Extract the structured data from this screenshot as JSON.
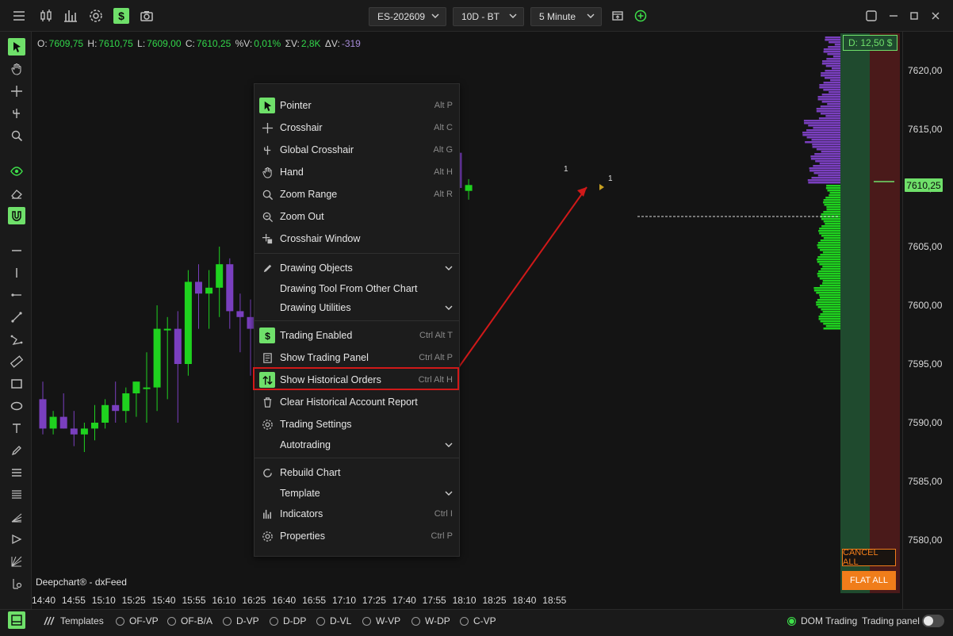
{
  "topbar": {
    "symbol": "ES-202609",
    "range": "10D - BT",
    "timeframe": "5 Minute"
  },
  "ohlc": {
    "o_label": "O:",
    "o_value": "7609,75",
    "h_label": "H:",
    "h_value": "7610,75",
    "l_label": "L:",
    "l_value": "7609,00",
    "c_label": "C:",
    "c_value": "7610,25",
    "pctv_label": "%V:",
    "pctv_value": "0,01%",
    "sumv_label": "ΣV:",
    "sumv_value": "2,8K",
    "dv_label": "ΔV:",
    "dv_value": "-319"
  },
  "vendor": "Deepchart® - dxFeed",
  "time_ticks": [
    "14:40",
    "14:55",
    "15:10",
    "15:25",
    "15:40",
    "15:55",
    "16:10",
    "16:25",
    "16:40",
    "16:55",
    "17:10",
    "17:25",
    "17:40",
    "17:55",
    "18:10",
    "18:25",
    "18:40",
    "18:55"
  ],
  "price_ticks": [
    "7620,00",
    "7615,00",
    "7610,00",
    "7605,00",
    "7600,00",
    "7595,00",
    "7590,00",
    "7585,00",
    "7580,00"
  ],
  "last_price": "7610,25",
  "dom": {
    "badge": "D: 12,50 $",
    "cancel_all": "CANCEL ALL",
    "flat_all": "FLAT ALL"
  },
  "order_marker": "1",
  "menu": {
    "pointer": {
      "label": "Pointer",
      "shortcut": "Alt P"
    },
    "crosshair": {
      "label": "Crosshair",
      "shortcut": "Alt C"
    },
    "global_crosshair": {
      "label": "Global Crosshair",
      "shortcut": "Alt G"
    },
    "hand": {
      "label": "Hand",
      "shortcut": "Alt H"
    },
    "zoom_range": {
      "label": "Zoom Range",
      "shortcut": "Alt R"
    },
    "zoom_out": {
      "label": "Zoom Out"
    },
    "crosshair_window": {
      "label": "Crosshair Window"
    },
    "drawing_objects": {
      "label": "Drawing Objects"
    },
    "drawing_tool_other": {
      "label": "Drawing Tool From Other Chart"
    },
    "drawing_utilities": {
      "label": "Drawing Utilities"
    },
    "trading_enabled": {
      "label": "Trading Enabled",
      "shortcut": "Ctrl Alt T"
    },
    "show_trading_panel": {
      "label": "Show Trading Panel",
      "shortcut": "Ctrl Alt P"
    },
    "show_historical_orders": {
      "label": "Show Historical Orders",
      "shortcut": "Ctrl Alt H"
    },
    "clear_historical_report": {
      "label": "Clear Historical Account Report"
    },
    "trading_settings": {
      "label": "Trading Settings"
    },
    "autotrading": {
      "label": "Autotrading"
    },
    "rebuild_chart": {
      "label": "Rebuild Chart"
    },
    "template": {
      "label": "Template"
    },
    "indicators": {
      "label": "Indicators",
      "shortcut": "Ctrl I"
    },
    "properties": {
      "label": "Properties",
      "shortcut": "Ctrl P"
    }
  },
  "bottombar": {
    "templates": "Templates",
    "presets": [
      "OF-VP",
      "OF-B/A",
      "D-VP",
      "D-DP",
      "D-VL",
      "W-VP",
      "W-DP",
      "C-VP"
    ],
    "dom_trading": "DOM Trading",
    "trading_panel": "Trading panel"
  },
  "colors": {
    "accent_green": "#6fe06a",
    "bull_candle": "#1fd21f",
    "bear_candle": "#7a3fbf",
    "highlight_red": "#d01919",
    "orange": "#f07d1a"
  },
  "chart_data": {
    "type": "candlestick",
    "interval": "5 Minute",
    "y_range": [
      7578,
      7624
    ],
    "candles": [
      {
        "o": 7592.0,
        "h": 7593.5,
        "l": 7589.0,
        "c": 7589.5
      },
      {
        "o": 7589.5,
        "h": 7591.0,
        "l": 7589.0,
        "c": 7590.5
      },
      {
        "o": 7590.5,
        "h": 7592.5,
        "l": 7589.5,
        "c": 7589.5
      },
      {
        "o": 7589.5,
        "h": 7591.0,
        "l": 7588.0,
        "c": 7589.0
      },
      {
        "o": 7589.0,
        "h": 7590.0,
        "l": 7587.5,
        "c": 7589.5
      },
      {
        "o": 7589.5,
        "h": 7591.5,
        "l": 7588.5,
        "c": 7590.0
      },
      {
        "o": 7590.0,
        "h": 7592.0,
        "l": 7589.5,
        "c": 7591.5
      },
      {
        "o": 7591.5,
        "h": 7593.5,
        "l": 7590.0,
        "c": 7591.0
      },
      {
        "o": 7591.0,
        "h": 7593.0,
        "l": 7590.0,
        "c": 7592.5
      },
      {
        "o": 7592.5,
        "h": 7593.5,
        "l": 7590.5,
        "c": 7593.5
      },
      {
        "o": 7593.0,
        "h": 7596.0,
        "l": 7590.0,
        "c": 7593.0
      },
      {
        "o": 7593.0,
        "h": 7600.0,
        "l": 7591.0,
        "c": 7598.0
      },
      {
        "o": 7598.0,
        "h": 7599.0,
        "l": 7592.0,
        "c": 7598.0
      },
      {
        "o": 7598.0,
        "h": 7599.5,
        "l": 7590.0,
        "c": 7595.0
      },
      {
        "o": 7595.0,
        "h": 7603.0,
        "l": 7594.0,
        "c": 7602.0
      },
      {
        "o": 7602.0,
        "h": 7603.5,
        "l": 7598.0,
        "c": 7601.0
      },
      {
        "o": 7601.0,
        "h": 7603.0,
        "l": 7598.0,
        "c": 7601.5
      },
      {
        "o": 7601.5,
        "h": 7605.0,
        "l": 7599.0,
        "c": 7603.5
      },
      {
        "o": 7603.5,
        "h": 7604.0,
        "l": 7598.0,
        "c": 7599.5
      },
      {
        "o": 7599.5,
        "h": 7601.0,
        "l": 7596.0,
        "c": 7599.0
      },
      {
        "o": 7599.0,
        "h": 7600.5,
        "l": 7594.0,
        "c": 7598.0
      },
      {
        "o": 7598.0,
        "h": 7601.0,
        "l": 7596.5,
        "c": 7600.0
      },
      {
        "o": 7600.0,
        "h": 7603.0,
        "l": 7599.0,
        "c": 7602.5
      },
      {
        "o": 7602.5,
        "h": 7604.5,
        "l": 7600.5,
        "c": 7600.5
      },
      {
        "o": 7600.5,
        "h": 7603.5,
        "l": 7599.0,
        "c": 7603.0
      },
      {
        "o": 7603.0,
        "h": 7604.5,
        "l": 7601.5,
        "c": 7604.0
      },
      {
        "o": 7604.0,
        "h": 7606.0,
        "l": 7602.5,
        "c": 7605.5
      },
      {
        "o": 7605.5,
        "h": 7606.5,
        "l": 7603.0,
        "c": 7603.5
      },
      {
        "o": 7603.5,
        "h": 7604.5,
        "l": 7600.5,
        "c": 7601.5
      },
      {
        "o": 7601.5,
        "h": 7603.5,
        "l": 7600.5,
        "c": 7603.0
      },
      {
        "o": 7603.0,
        "h": 7608.5,
        "l": 7602.5,
        "c": 7608.0
      },
      {
        "o": 7608.0,
        "h": 7608.5,
        "l": 7603.0,
        "c": 7604.0
      },
      {
        "o": 7604.0,
        "h": 7607.0,
        "l": 7603.0,
        "c": 7606.0
      },
      {
        "o": 7606.0,
        "h": 7607.5,
        "l": 7603.5,
        "c": 7604.0
      },
      {
        "o": 7604.0,
        "h": 7606.5,
        "l": 7601.5,
        "c": 7606.5
      },
      {
        "o": 7606.5,
        "h": 7608.0,
        "l": 7603.0,
        "c": 7604.5
      },
      {
        "o": 7604.5,
        "h": 7608.5,
        "l": 7603.5,
        "c": 7607.5
      },
      {
        "o": 7607.5,
        "h": 7611.0,
        "l": 7606.5,
        "c": 7609.0
      },
      {
        "o": 7609.0,
        "h": 7613.5,
        "l": 7608.0,
        "c": 7612.5
      },
      {
        "o": 7612.5,
        "h": 7614.0,
        "l": 7611.0,
        "c": 7613.0
      },
      {
        "o": 7613.0,
        "h": 7613.5,
        "l": 7609.0,
        "c": 7610.0
      },
      {
        "o": 7609.75,
        "h": 7610.75,
        "l": 7609.0,
        "c": 7610.25
      }
    ]
  }
}
